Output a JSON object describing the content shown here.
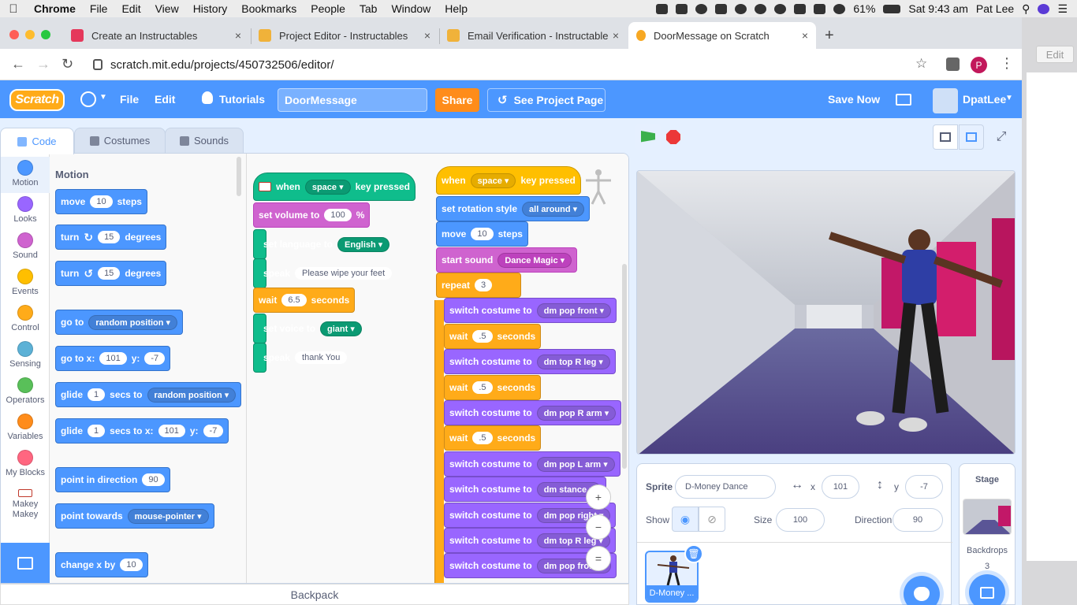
{
  "mac_menubar": {
    "app": "Chrome",
    "items": [
      "File",
      "Edit",
      "View",
      "History",
      "Bookmarks",
      "People",
      "Tab",
      "Window",
      "Help"
    ],
    "battery": "61%",
    "clock": "Sat 9:43 am",
    "user": "Pat Lee"
  },
  "browser": {
    "tabs": [
      {
        "title": "Create an Instructables",
        "favicon_color": "#e5385b"
      },
      {
        "title": "Project Editor - Instructables",
        "favicon_color": "#f0b23a"
      },
      {
        "title": "Email Verification - Instructables",
        "favicon_color": "#f0b23a"
      },
      {
        "title": "DoorMessage on Scratch",
        "favicon_color": "#f7a823"
      }
    ],
    "close_glyph": "×",
    "new_tab_glyph": "+",
    "url": "scratch.mit.edu/projects/450732506/editor/",
    "profile_initial": "P",
    "right_stub_label": "Edit"
  },
  "scratch_menu": {
    "logo": "Scratch",
    "file": "File",
    "edit": "Edit",
    "tutorials": "Tutorials",
    "project_title": "DoorMessage",
    "share": "Share",
    "see_project_page": "See Project Page",
    "save_now": "Save Now",
    "username": "DpatLee"
  },
  "editor_tabs": {
    "code": "Code",
    "costumes": "Costumes",
    "sounds": "Sounds"
  },
  "categories": [
    {
      "label": "Motion",
      "color": "#4c97ff"
    },
    {
      "label": "Looks",
      "color": "#9966ff"
    },
    {
      "label": "Sound",
      "color": "#cf63cf"
    },
    {
      "label": "Events",
      "color": "#ffbf00"
    },
    {
      "label": "Control",
      "color": "#ffab19"
    },
    {
      "label": "Sensing",
      "color": "#5cb1d6"
    },
    {
      "label": "Operators",
      "color": "#59c059"
    },
    {
      "label": "Variables",
      "color": "#ff8c1a"
    },
    {
      "label": "My Blocks",
      "color": "#ff6680"
    },
    {
      "label": "Makey Makey",
      "color": "#0fbd8c"
    }
  ],
  "palette": {
    "title": "Motion",
    "move": {
      "a": "move",
      "n": "10",
      "b": "steps"
    },
    "turn_right": {
      "a": "turn",
      "n": "15",
      "b": "degrees"
    },
    "turn_left": {
      "a": "turn",
      "n": "15",
      "b": "degrees"
    },
    "goto": {
      "a": "go to",
      "dd": "random position"
    },
    "goto_xy": {
      "a": "go to x:",
      "x": "101",
      "b": "y:",
      "y": "-7"
    },
    "glide": {
      "a": "glide",
      "n": "1",
      "b": "secs to",
      "dd": "random position"
    },
    "glide_xy": {
      "a": "glide",
      "n": "1",
      "b": "secs to x:",
      "x": "101",
      "c": "y:",
      "y": "-7"
    },
    "point_dir": {
      "a": "point in direction",
      "n": "90"
    },
    "point_towards": {
      "a": "point towards",
      "dd": "mouse-pointer"
    },
    "change_x": {
      "a": "change x by",
      "n": "10"
    }
  },
  "script1": {
    "hat": {
      "when": "when",
      "key": "space",
      "pressed": "key pressed"
    },
    "volume": {
      "a": "set volume to",
      "n": "100",
      "b": "%"
    },
    "language": {
      "a": "set language to",
      "dd": "English"
    },
    "speak1": {
      "a": "speak",
      "t": "Please wipe your feet"
    },
    "wait": {
      "a": "wait",
      "n": "6.5",
      "b": "seconds"
    },
    "voice": {
      "a": "set voice to",
      "dd": "giant"
    },
    "speak2": {
      "a": "speak",
      "t": "thank You"
    }
  },
  "script2": {
    "hat": {
      "when": "when",
      "key": "space",
      "pressed": "key pressed"
    },
    "rotation": {
      "a": "set rotation style",
      "dd": "all around"
    },
    "move": {
      "a": "move",
      "n": "10",
      "b": "steps"
    },
    "sound": {
      "a": "start sound",
      "dd": "Dance Magic"
    },
    "repeat": {
      "a": "repeat",
      "n": "3"
    },
    "costume_label": "switch costume to",
    "wait_label": "wait",
    "seconds_label": "seconds",
    "wait_value": ".5",
    "costumes": [
      "dm pop front",
      "dm top R leg",
      "dm pop R arm",
      "dm pop L arm",
      "dm stance",
      "dm pop right",
      "dm top R leg",
      "dm pop front"
    ]
  },
  "canvas_controls": {
    "zoom_in": "+",
    "zoom_out": "−",
    "reset": "="
  },
  "backpack": "Backpack",
  "sprite_info": {
    "sprite_label": "Sprite",
    "sprite_name": "D-Money Dance",
    "x_label": "x",
    "x": "101",
    "y_label": "y",
    "y": "-7",
    "show_label": "Show",
    "size_label": "Size",
    "size": "100",
    "direction_label": "Direction",
    "direction": "90",
    "thumb_label": "D-Money ..."
  },
  "stage_panel": {
    "title": "Stage",
    "backdrops_label": "Backdrops",
    "backdrops_count": "3"
  }
}
